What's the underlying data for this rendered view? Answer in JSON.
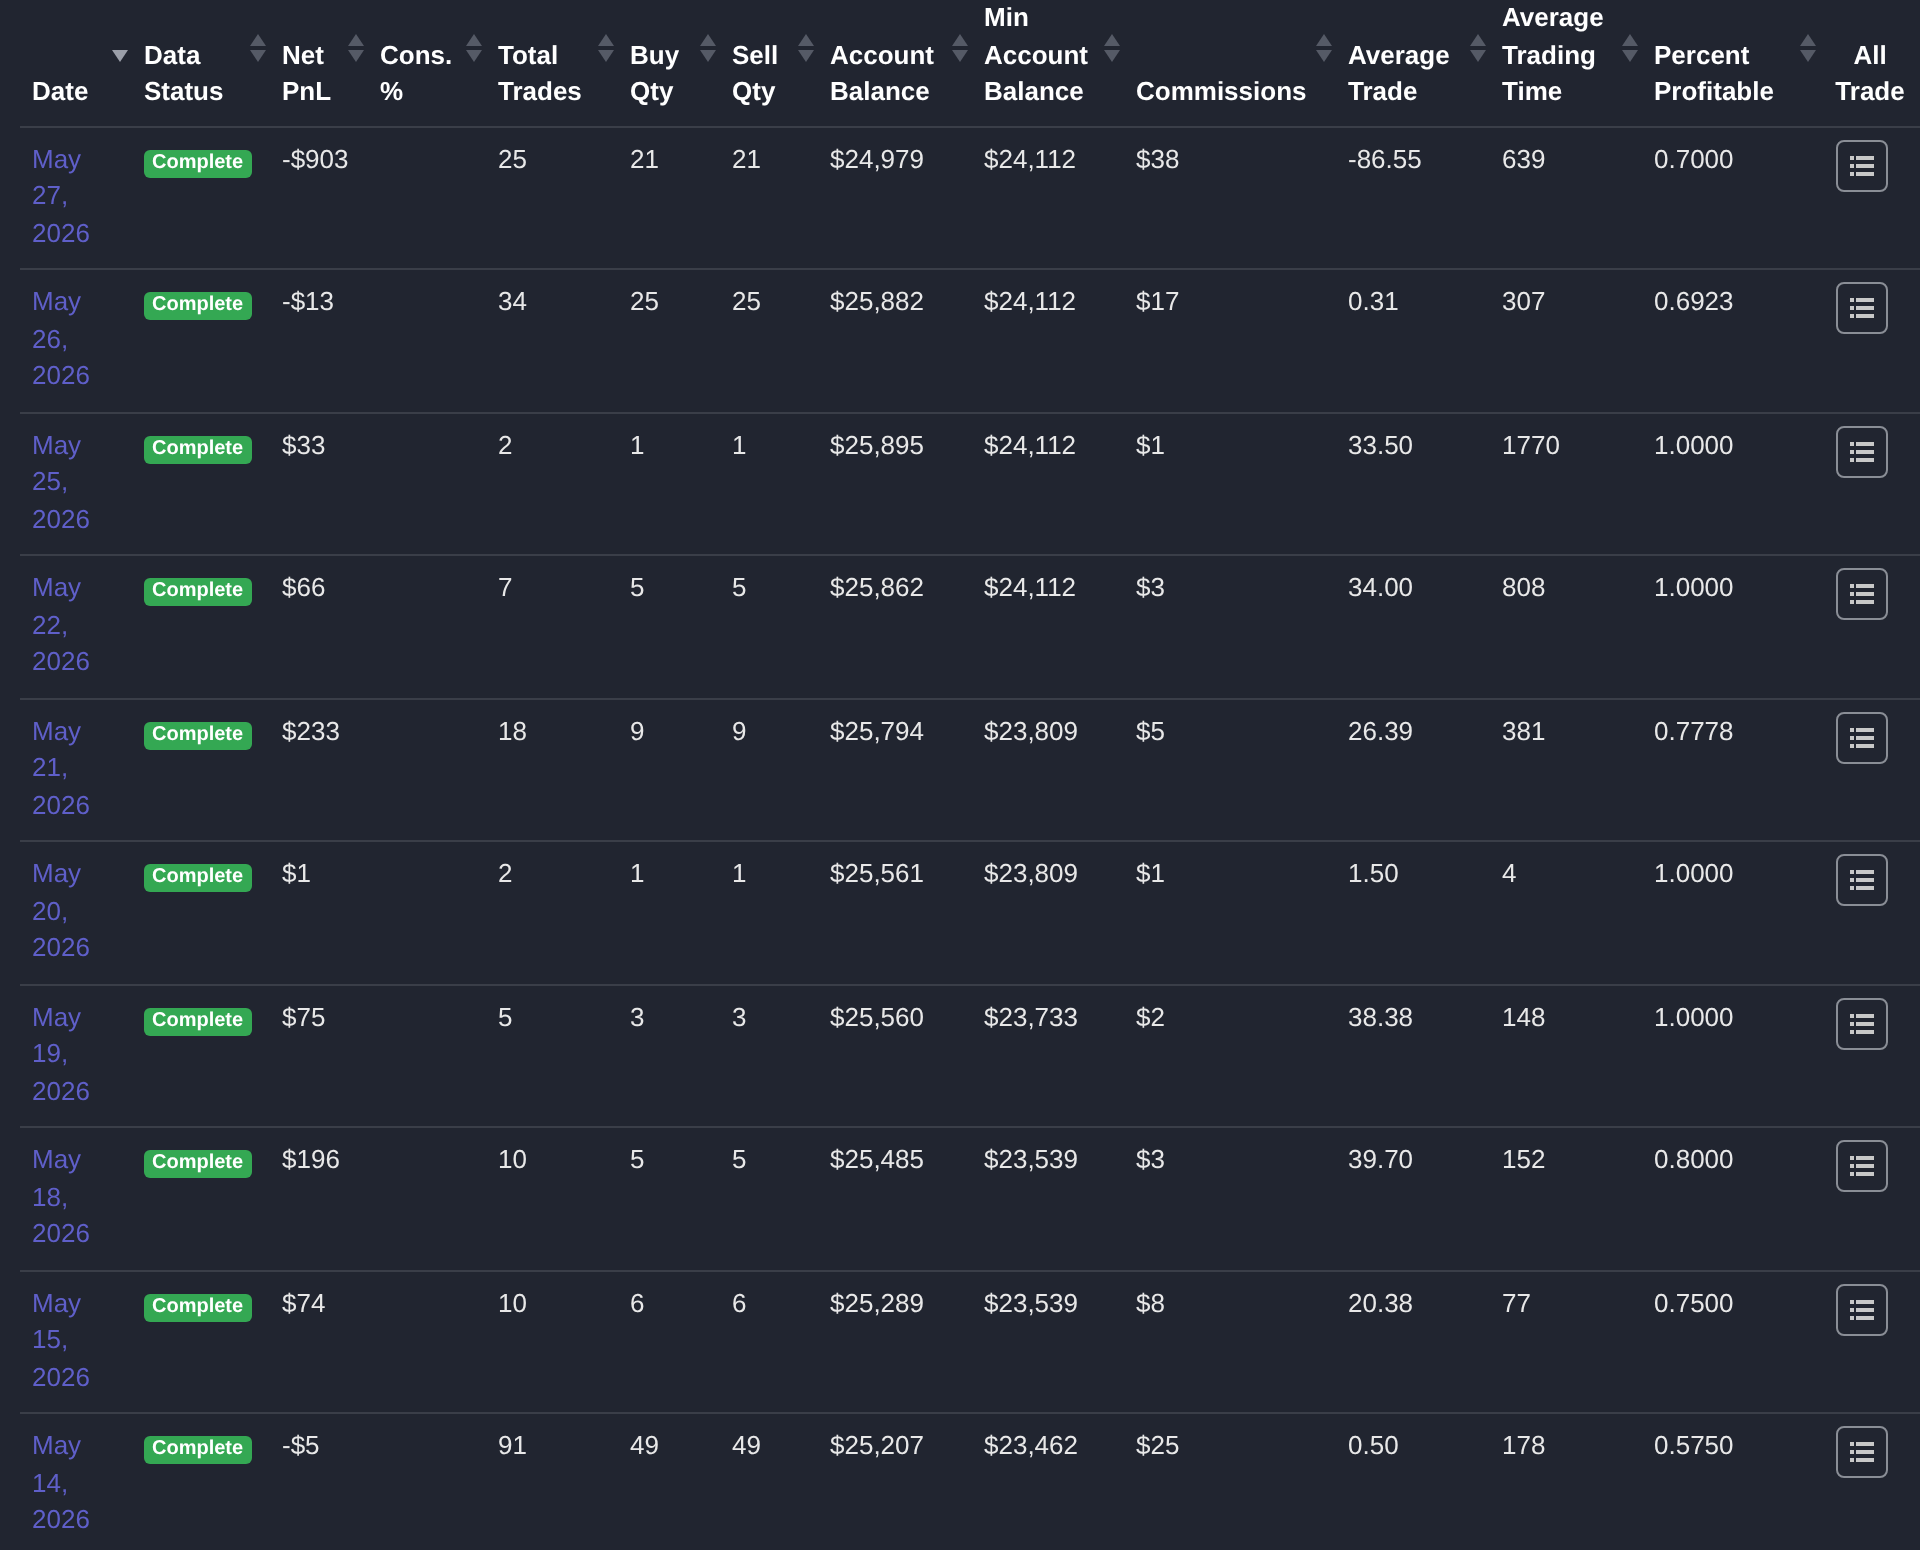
{
  "table": {
    "columns": [
      {
        "label": "Date",
        "sorted": true
      },
      {
        "label": "Data Status",
        "sorted": false
      },
      {
        "label": "Net PnL",
        "sorted": false
      },
      {
        "label": "Cons. %",
        "sorted": false
      },
      {
        "label": "Total Trades",
        "sorted": false
      },
      {
        "label": "Buy Qty",
        "sorted": false
      },
      {
        "label": "Sell Qty",
        "sorted": false
      },
      {
        "label": "Account Balance",
        "sorted": false
      },
      {
        "label": "Min Account Balance",
        "sorted": false
      },
      {
        "label": "Commissions",
        "sorted": false
      },
      {
        "label": "Average Trade",
        "sorted": false
      },
      {
        "label": "Average Trading Time",
        "sorted": false
      },
      {
        "label": "Percent Profitable",
        "sorted": false
      },
      {
        "label": "All Trade"
      }
    ],
    "rows": [
      {
        "date": "May 27, 2026",
        "status": "Complete",
        "net_pnl": "-$903",
        "total_trades": "25",
        "buy_qty": "21",
        "sell_qty": "21",
        "account_balance": "$24,979",
        "min_account_balance": "$24,112",
        "commissions": "$38",
        "average_trade": "-86.55",
        "average_trading_time": "639",
        "percent_profitable": "0.7000"
      },
      {
        "date": "May 26, 2026",
        "status": "Complete",
        "net_pnl": "-$13",
        "total_trades": "34",
        "buy_qty": "25",
        "sell_qty": "25",
        "account_balance": "$25,882",
        "min_account_balance": "$24,112",
        "commissions": "$17",
        "average_trade": "0.31",
        "average_trading_time": "307",
        "percent_profitable": "0.6923"
      },
      {
        "date": "May 25, 2026",
        "status": "Complete",
        "net_pnl": "$33",
        "total_trades": "2",
        "buy_qty": "1",
        "sell_qty": "1",
        "account_balance": "$25,895",
        "min_account_balance": "$24,112",
        "commissions": "$1",
        "average_trade": "33.50",
        "average_trading_time": "1770",
        "percent_profitable": "1.0000"
      },
      {
        "date": "May 22, 2026",
        "status": "Complete",
        "net_pnl": "$66",
        "total_trades": "7",
        "buy_qty": "5",
        "sell_qty": "5",
        "account_balance": "$25,862",
        "min_account_balance": "$24,112",
        "commissions": "$3",
        "average_trade": "34.00",
        "average_trading_time": "808",
        "percent_profitable": "1.0000"
      },
      {
        "date": "May 21, 2026",
        "status": "Complete",
        "net_pnl": "$233",
        "total_trades": "18",
        "buy_qty": "9",
        "sell_qty": "9",
        "account_balance": "$25,794",
        "min_account_balance": "$23,809",
        "commissions": "$5",
        "average_trade": "26.39",
        "average_trading_time": "381",
        "percent_profitable": "0.7778"
      },
      {
        "date": "May 20, 2026",
        "status": "Complete",
        "net_pnl": "$1",
        "total_trades": "2",
        "buy_qty": "1",
        "sell_qty": "1",
        "account_balance": "$25,561",
        "min_account_balance": "$23,809",
        "commissions": "$1",
        "average_trade": "1.50",
        "average_trading_time": "4",
        "percent_profitable": "1.0000"
      },
      {
        "date": "May 19, 2026",
        "status": "Complete",
        "net_pnl": "$75",
        "total_trades": "5",
        "buy_qty": "3",
        "sell_qty": "3",
        "account_balance": "$25,560",
        "min_account_balance": "$23,733",
        "commissions": "$2",
        "average_trade": "38.38",
        "average_trading_time": "148",
        "percent_profitable": "1.0000"
      },
      {
        "date": "May 18, 2026",
        "status": "Complete",
        "net_pnl": "$196",
        "total_trades": "10",
        "buy_qty": "5",
        "sell_qty": "5",
        "account_balance": "$25,485",
        "min_account_balance": "$23,539",
        "commissions": "$3",
        "average_trade": "39.70",
        "average_trading_time": "152",
        "percent_profitable": "0.8000"
      },
      {
        "date": "May 15, 2026",
        "status": "Complete",
        "net_pnl": "$74",
        "total_trades": "10",
        "buy_qty": "6",
        "sell_qty": "6",
        "account_balance": "$25,289",
        "min_account_balance": "$23,539",
        "commissions": "$8",
        "average_trade": "20.38",
        "average_trading_time": "77",
        "percent_profitable": "0.7500"
      },
      {
        "date": "May 14, 2026",
        "status": "Complete",
        "net_pnl": "-$5",
        "total_trades": "91",
        "buy_qty": "49",
        "sell_qty": "49",
        "account_balance": "$25,207",
        "min_account_balance": "$23,462",
        "commissions": "$25",
        "average_trade": "0.50",
        "average_trading_time": "178",
        "percent_profitable": "0.5750"
      }
    ]
  }
}
